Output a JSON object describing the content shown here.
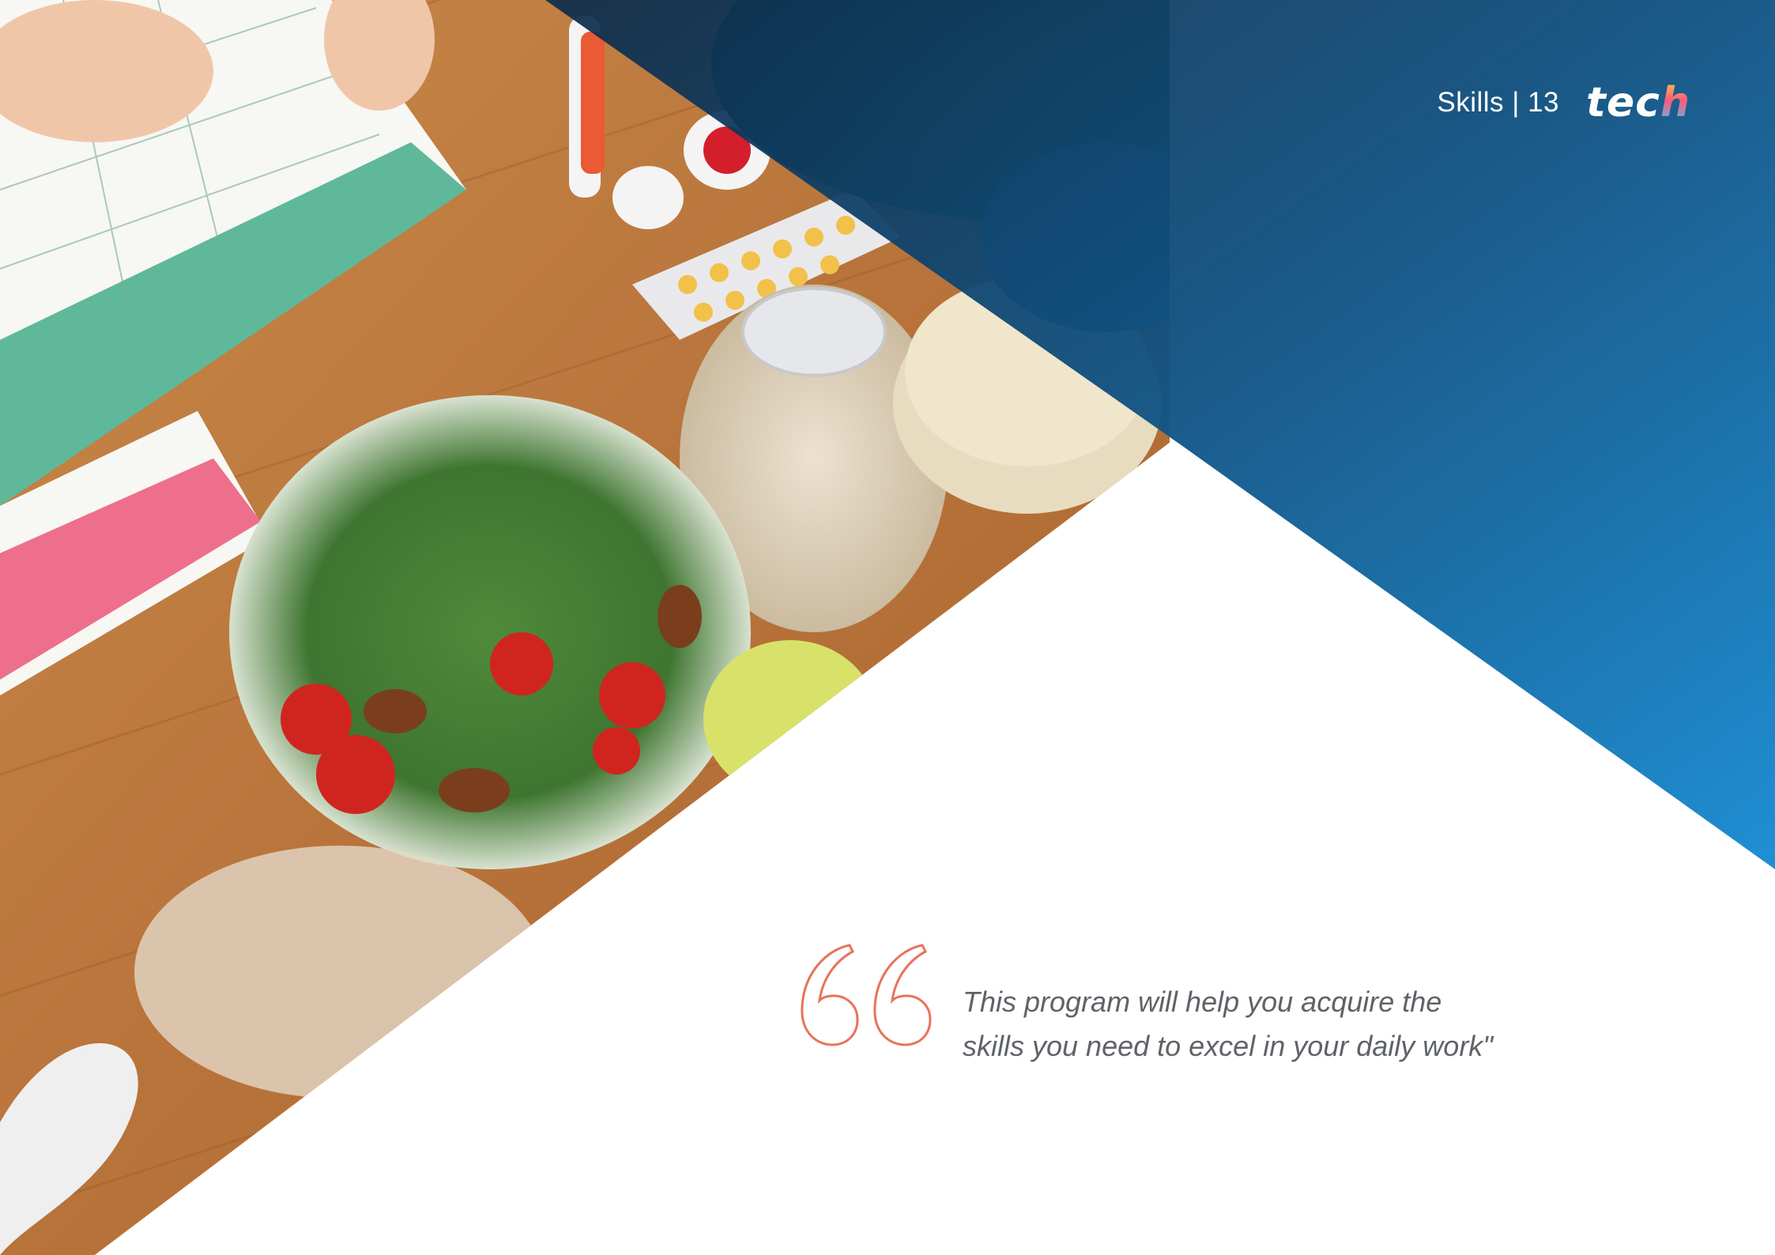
{
  "header": {
    "section": "Skills | 13",
    "logo_main": "tec",
    "logo_accent": "h"
  },
  "quote": {
    "text": "This program will help you acquire the skills you need to excel in your daily work\""
  },
  "colors": {
    "blue_dark": "#0d3b66",
    "blue_light": "#1f8fd4",
    "quote_mark": "#e8735a",
    "quote_text": "#5f6368"
  },
  "photo": {
    "subject": "meal-plan-food-photo"
  }
}
